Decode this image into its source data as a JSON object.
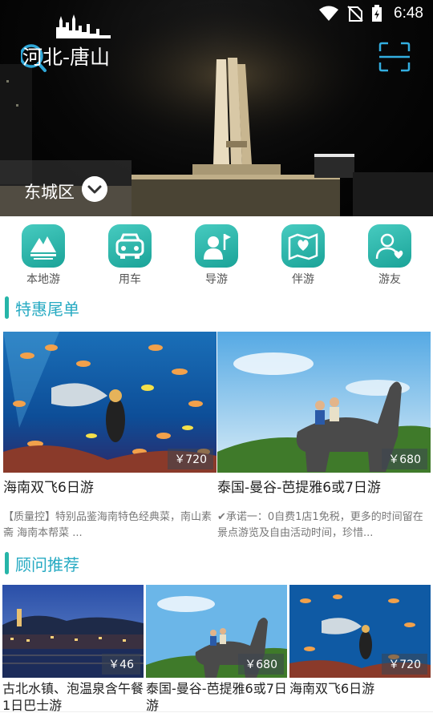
{
  "status_bar": {
    "time": "6:48"
  },
  "header": {
    "city_title": "河北-唐山",
    "district": "东城区"
  },
  "categories": [
    {
      "label": "本地游",
      "icon": "mountain-icon"
    },
    {
      "label": "用车",
      "icon": "car-icon"
    },
    {
      "label": "导游",
      "icon": "guide-flag-icon"
    },
    {
      "label": "伴游",
      "icon": "map-heart-icon"
    },
    {
      "label": "游友",
      "icon": "friend-heart-icon"
    }
  ],
  "deals_section": {
    "title": "特惠尾单",
    "items": [
      {
        "price": "￥720",
        "title": "海南双飞6日游",
        "desc": "【质量控】特别品鉴海南特色经典菜，南山素斋 海南本帮菜 ..."
      },
      {
        "price": "￥680",
        "title": "泰国-曼谷-芭提雅6或7日游",
        "desc": "✔承诺一：0自费1店1免税，更多的时间留在景点游览及自由活动时间，珍惜..."
      }
    ]
  },
  "recommend_section": {
    "title": "顾问推荐",
    "items": [
      {
        "price": "￥46",
        "title": "古北水镇、泡温泉含午餐1日巴士游"
      },
      {
        "price": "￥680",
        "title": "泰国-曼谷-芭提雅6或7日游"
      },
      {
        "price": "￥720",
        "title": "海南双飞6日游"
      }
    ]
  },
  "colors": {
    "accent": "#26b5a8",
    "section_title": "#26aac2"
  }
}
